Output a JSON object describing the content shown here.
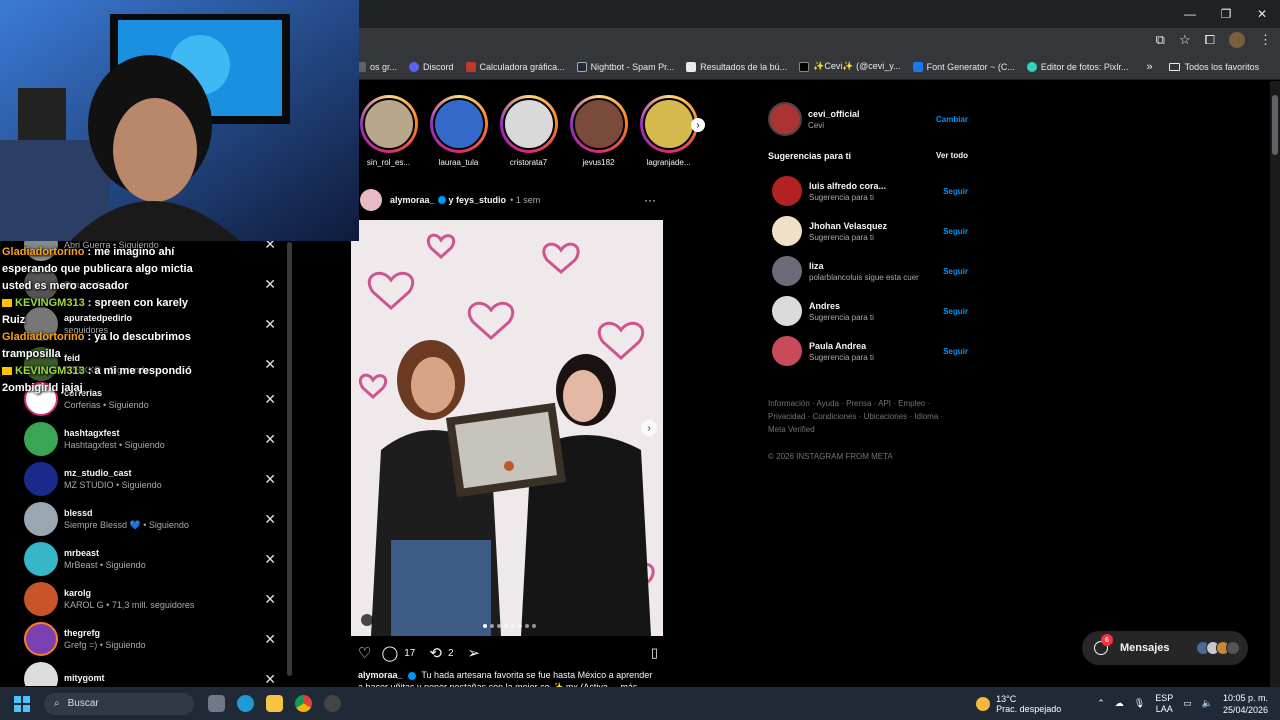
{
  "window": {
    "minimize": "—",
    "restore": "❐",
    "close": "✕"
  },
  "bookmarks": {
    "items": [
      {
        "label": "os gr...",
        "color": "#5f6368"
      },
      {
        "label": "Discord",
        "color": "#5865f2"
      },
      {
        "label": "Calculadora gráfica...",
        "color": "#c1392b"
      },
      {
        "label": "Nightbot - Spam Pr...",
        "color": "#1d2b3a"
      },
      {
        "label": "Resultados de la bú...",
        "color": "#e8eaed"
      },
      {
        "label": "✨Cevi✨ (@cevi_y...",
        "color": "#000000"
      },
      {
        "label": "Font Generator ~ (C...",
        "color": "#1877f2"
      },
      {
        "label": "Editor de fotos: Pixlr...",
        "color": "#2dd4bf"
      }
    ],
    "more": "»",
    "folder": "Todos los favoritos"
  },
  "stories": [
    {
      "name": "sin_rol_es...",
      "color": "#b8a78a"
    },
    {
      "name": "lauraa_tula",
      "color": "#3468c9"
    },
    {
      "name": "cristorata7",
      "color": "#d9d9d9"
    },
    {
      "name": "jevus182",
      "color": "#7a4b3a"
    },
    {
      "name": "lagranjade...",
      "color": "#d6b94c"
    }
  ],
  "post": {
    "author": "alymoraa_",
    "coauthor": "y feys_studio",
    "time": "• 1 sem",
    "more": "···",
    "likes_icon": "♡",
    "comments": "17",
    "reposts": "2",
    "caption_user": "alymoraa_",
    "caption_line1": "Tu hada artesana favorita se fue hasta México a aprender",
    "caption_line2": "a hacer uñitas y poner pestañas con la mejor co ✨ mx (Activa ... más"
  },
  "sidebar": {
    "me": {
      "username": "cevi_official",
      "name": "Cevi",
      "action": "Cambiar"
    },
    "suggestions_title": "Sugerencias para ti",
    "see_all": "Ver todo",
    "suggestions": [
      {
        "username": "luis alfredo cora...",
        "sub": "Sugerencia para ti",
        "action": "Seguir",
        "color": "#b22222"
      },
      {
        "username": "Jhohan Velasquez",
        "sub": "Sugerencia para ti",
        "action": "Seguir",
        "color": "#f0e0c8"
      },
      {
        "username": "liza",
        "sub": "polarblancoluis sigue esta cuer",
        "action": "Seguir",
        "color": "#6b6b7a"
      },
      {
        "username": "Andres",
        "sub": "Sugerencia para ti",
        "action": "Seguir",
        "color": "#dbdbdb"
      },
      {
        "username": "Paula Andrea",
        "sub": "Sugerencia para ti",
        "action": "Seguir",
        "color": "#c94a5a"
      }
    ],
    "footer": "Información · Ayuda · Prensa · API · Empleo · Privacidad · Condiciones · Ubicaciones · Idioma · Meta Verified",
    "copyright": "© 2026 INSTAGRAM FROM META"
  },
  "messages": {
    "label": "Mensajes",
    "badge": "6"
  },
  "following": [
    {
      "name": "",
      "sub": "Abri Guerra • Siguiendo",
      "color": "#888888"
    },
    {
      "name": "",
      "sub": "Siguiendo",
      "color": "#555555"
    },
    {
      "name": "apuratedpedirlo",
      "sub": "seguidores",
      "color": "#777777"
    },
    {
      "name": "feid",
      "sub": "FERXXO • Siguiendo",
      "color": "#3b5b2b"
    },
    {
      "name": "corferias",
      "sub": "Corferias • Siguiendo",
      "color": "#ffffff"
    },
    {
      "name": "hashtagxfest",
      "sub": "Hashtagxfest • Siguiendo",
      "color": "#3aa555"
    },
    {
      "name": "mz_studio_cast",
      "sub": "MZ STUDIO • Siguiendo",
      "color": "#1a2a8a"
    },
    {
      "name": "blessd",
      "sub": "Siempre Blessd 💙 • Siguiendo",
      "color": "#9aa7b0"
    },
    {
      "name": "mrbeast",
      "sub": "MrBeast • Siguiendo",
      "color": "#38b6c9"
    },
    {
      "name": "karolg",
      "sub": "KAROL G • 71,3 mill. seguidores",
      "color": "#c8552a"
    },
    {
      "name": "thegrefg",
      "sub": "Grefg =) • Siguiendo",
      "color": "#7a3fb0"
    },
    {
      "name": "mitygomt",
      "sub": "",
      "color": "#dddddd"
    }
  ],
  "chat": [
    {
      "user": "Gladiadortorino",
      "text": " : me imagino ahí esperando que publicara algo mictia usted es mero acosador",
      "style": "u1",
      "crown": false
    },
    {
      "user": "KEVINGM313",
      "text": " : spreen con karely Ruiz",
      "style": "u2",
      "crown": true
    },
    {
      "user": "Gladiadortorino",
      "text": " : ya lo descubrimos tramposilla",
      "style": "u1",
      "crown": false
    },
    {
      "user": "KEVINGM313",
      "text": " : a mi me respondió 2ombigirld jajaj",
      "style": "u2",
      "crown": true
    }
  ],
  "taskbar": {
    "search": "Buscar",
    "temp": "13°C",
    "weather": "Prac. despejado",
    "lang1": "ESP",
    "lang2": "LAA",
    "time": "10:05 p. m.",
    "date": "25/04/2026"
  }
}
